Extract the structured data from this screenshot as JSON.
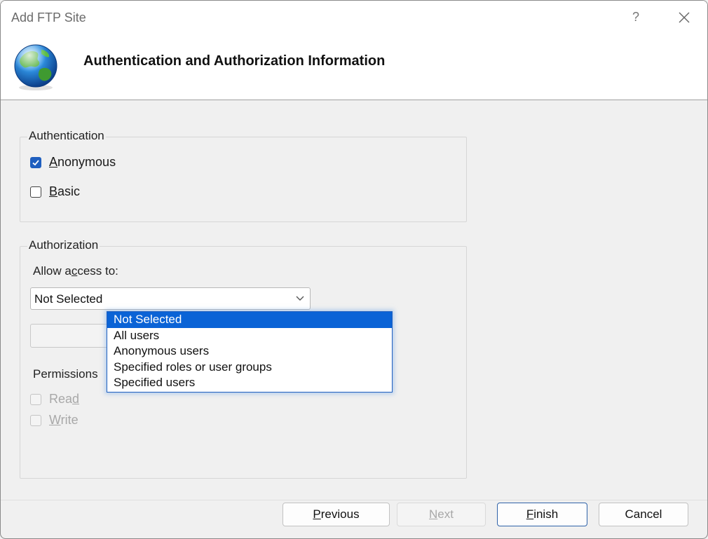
{
  "window": {
    "title": "Add FTP Site",
    "help_glyph": "?",
    "header_title": "Authentication and Authorization Information",
    "icon": "globe-icon"
  },
  "authentication": {
    "group_label": "Authentication",
    "anonymous": {
      "label_mnemonic": "A",
      "label_rest": "nonymous",
      "checked": true
    },
    "basic": {
      "label_mnemonic": "B",
      "label_rest": "asic",
      "checked": false
    }
  },
  "authorization": {
    "group_label": "Authorization",
    "allow_access_pre": "Allow a",
    "allow_access_mnemonic": "c",
    "allow_access_post": "cess to:",
    "selected_value": "Not Selected",
    "options": [
      "Not Selected",
      "All users",
      "Anonymous users",
      "Specified roles or user groups",
      "Specified users"
    ],
    "highlighted_index": 0,
    "permissions_label": "Permissions",
    "read": {
      "label_pre": "Rea",
      "label_mnemonic": "d",
      "checked": false,
      "enabled": false
    },
    "write": {
      "label_mnemonic": "W",
      "label_rest": "rite",
      "checked": false,
      "enabled": false
    }
  },
  "buttons": {
    "previous": {
      "mnemonic": "P",
      "rest": "revious",
      "enabled": true
    },
    "next": {
      "mnemonic": "N",
      "rest": "ext",
      "enabled": false
    },
    "finish": {
      "mnemonic": "F",
      "rest": "inish",
      "enabled": true
    },
    "cancel": {
      "label": "Cancel",
      "enabled": true
    }
  },
  "colors": {
    "accent": "#0a63d6",
    "checkbox_checked": "#1f5fbf"
  }
}
